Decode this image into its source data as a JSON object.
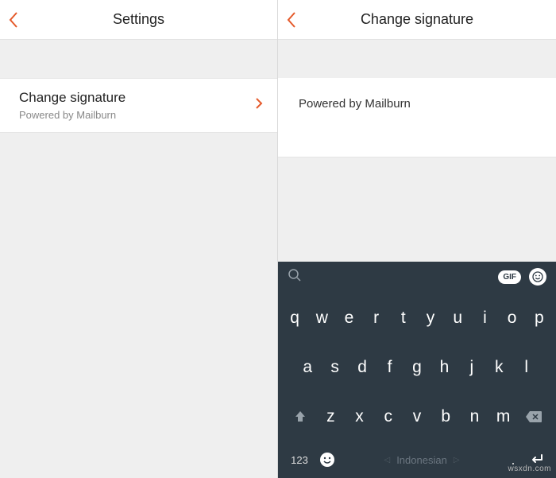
{
  "left": {
    "title": "Settings",
    "cell": {
      "primary": "Change signature",
      "secondary": "Powered by Mailburn"
    }
  },
  "right": {
    "title": "Change signature",
    "editor_value": "Powered by Mailburn"
  },
  "keyboard": {
    "gif_label": "GIF",
    "rows": {
      "r1": [
        "q",
        "w",
        "e",
        "r",
        "t",
        "y",
        "u",
        "i",
        "o",
        "p"
      ],
      "r2": [
        "a",
        "s",
        "d",
        "f",
        "g",
        "h",
        "j",
        "k",
        "l"
      ],
      "r3": [
        "z",
        "x",
        "c",
        "v",
        "b",
        "n",
        "m"
      ]
    },
    "numbers_label": "123",
    "language": "Indonesian",
    "period": "."
  },
  "watermark": "wsxdn.com"
}
